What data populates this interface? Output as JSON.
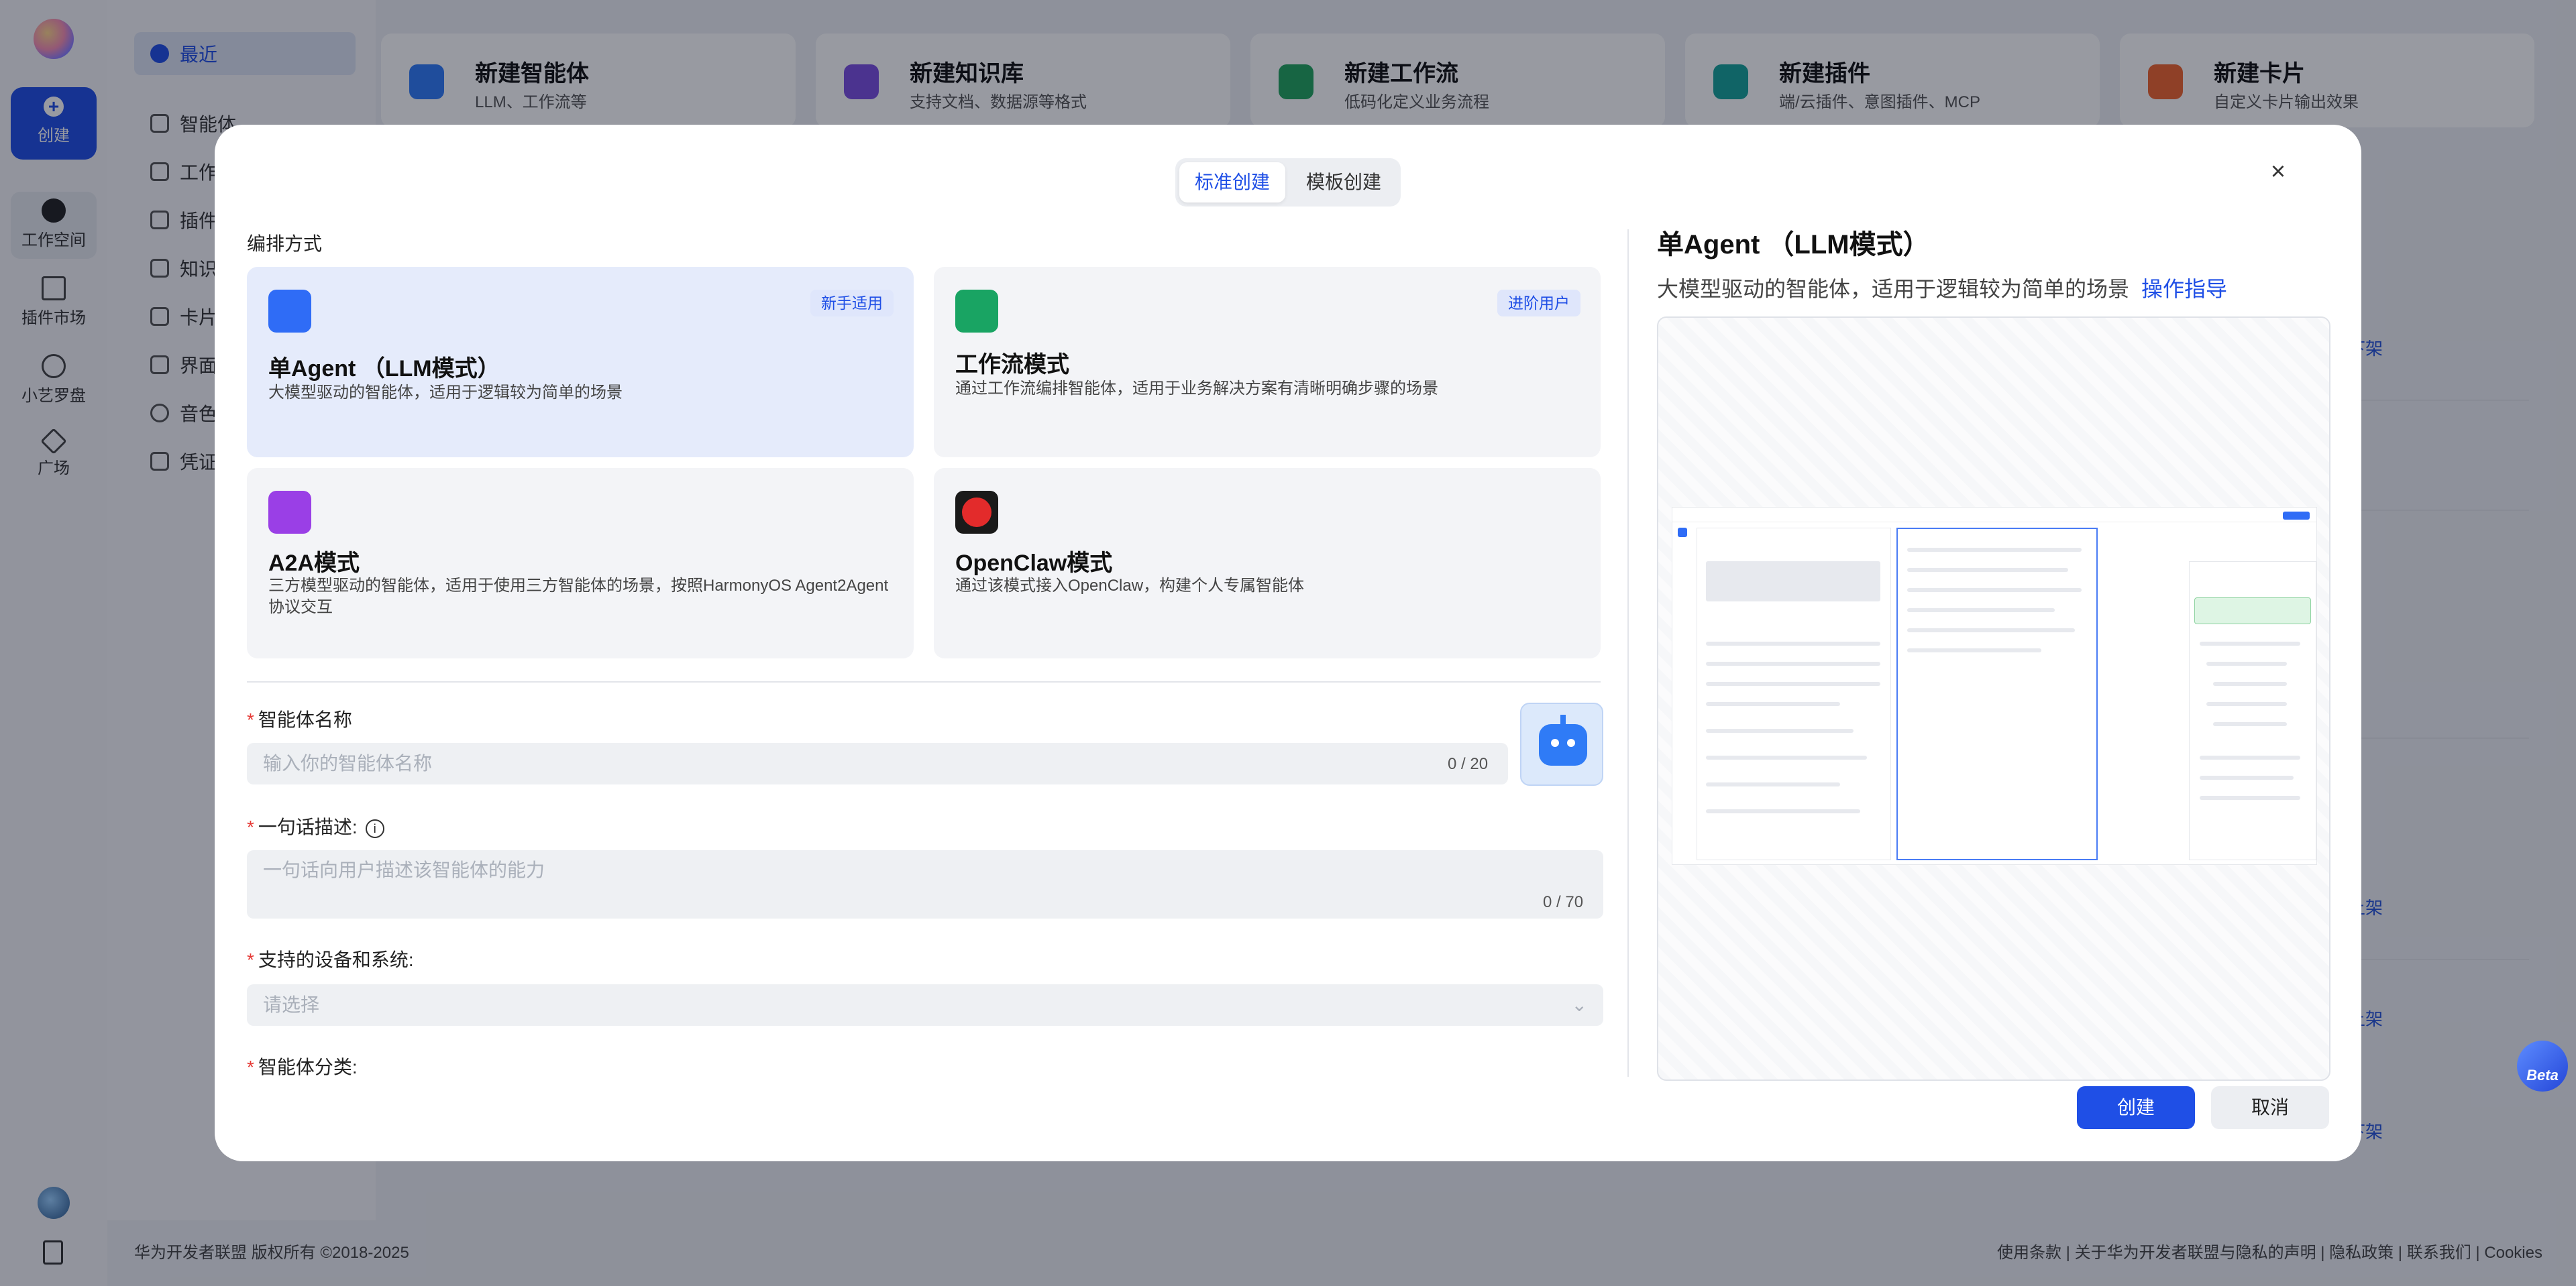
{
  "rail": {
    "create_label": "创建",
    "items": [
      {
        "label": "工作空间"
      },
      {
        "label": "插件市场"
      },
      {
        "label": "小艺罗盘"
      },
      {
        "label": "广场"
      }
    ]
  },
  "sidebar": {
    "items": [
      {
        "label": "最近"
      },
      {
        "label": "智能体"
      },
      {
        "label": "工作"
      },
      {
        "label": "插件"
      },
      {
        "label": "知识"
      },
      {
        "label": "卡片"
      },
      {
        "label": "界面"
      },
      {
        "label": "音色"
      },
      {
        "label": "凭证"
      }
    ]
  },
  "quick_create": [
    {
      "title": "新建智能体",
      "subtitle": "LLM、工作流等",
      "color": "#2f7bf6"
    },
    {
      "title": "新建知识库",
      "subtitle": "支持文档、数据源等格式",
      "color": "#7b4fe0"
    },
    {
      "title": "新建工作流",
      "subtitle": "低码化定义业务流程",
      "color": "#22a45d"
    },
    {
      "title": "新建插件",
      "subtitle": "端/云插件、意图插件、MCP",
      "color": "#16a39a"
    },
    {
      "title": "新建卡片",
      "subtitle": "自定义卡片输出效果",
      "color": "#f0642d"
    }
  ],
  "background_links": [
    "下架",
    "上架",
    "上架",
    "下架"
  ],
  "footer": {
    "copyright": "华为开发者联盟 版权所有 ©2018-2025",
    "links": "使用条款 | 关于华为开发者联盟与隐私的声明 | 隐私政策 | 联系我们 | Cookies"
  },
  "beta_label": "Beta",
  "modal": {
    "tabs": {
      "standard": "标准创建",
      "template": "模板创建"
    },
    "section_title": "编排方式",
    "modes": [
      {
        "title": "单Agent （LLM模式）",
        "desc": "大模型驱动的智能体，适用于逻辑较为简单的场景",
        "badge": "新手适用",
        "color": "#2f6cf6"
      },
      {
        "title": "工作流模式",
        "desc": "通过工作流编排智能体，适用于业务解决方案有清晰明确步骤的场景",
        "badge": "进阶用户",
        "color": "#19a463"
      },
      {
        "title": "A2A模式",
        "desc": "三方模型驱动的智能体，适用于使用三方智能体的场景，按照HarmonyOS Agent2Agent协议交互",
        "badge": "",
        "color": "#9a3fe6"
      },
      {
        "title": "OpenClaw模式",
        "desc": "通过该模式接入OpenClaw，构建个人专属智能体",
        "badge": "",
        "color": "#1a1a1a"
      }
    ],
    "fields": {
      "name_label": "智能体名称",
      "name_placeholder": "输入你的智能体名称",
      "name_count": "0 / 20",
      "desc_label": "一句话描述:",
      "desc_placeholder": "一句话向用户描述该智能体的能力",
      "desc_count": "0 / 70",
      "device_label": "支持的设备和系统:",
      "device_placeholder": "请选择",
      "category_label": "智能体分类:"
    },
    "preview": {
      "title": "单Agent （LLM模式）",
      "desc": "大模型驱动的智能体，适用于逻辑较为简单的场景",
      "guide_link": "操作指导"
    },
    "buttons": {
      "create": "创建",
      "cancel": "取消"
    }
  }
}
